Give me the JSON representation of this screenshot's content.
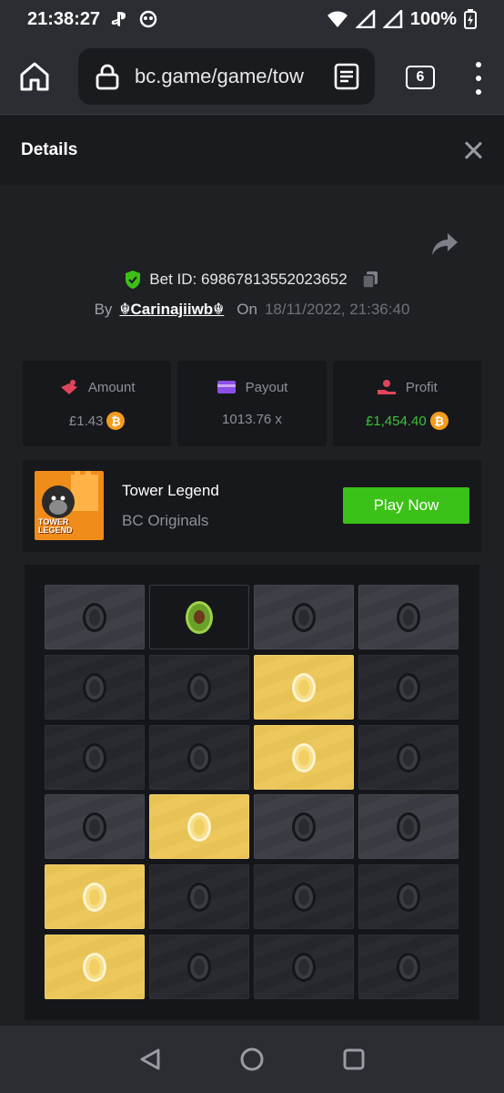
{
  "status_bar": {
    "time": "21:38:27",
    "battery": "100%"
  },
  "browser": {
    "url": "bc.game/game/tow",
    "tab_count": "6"
  },
  "panel": {
    "title": "Details"
  },
  "bet": {
    "id_text": "Bet ID: 69867813552023652",
    "by_label": "By",
    "username": "☬Carinajiiwb☬",
    "on_label": "On",
    "date": "18/11/2022, 21:36:40"
  },
  "stats": {
    "amount": {
      "label": "Amount",
      "value": "£1.43"
    },
    "payout": {
      "label": "Payout",
      "value": "1013.76 x"
    },
    "profit": {
      "label": "Profit",
      "value": "£1,454.40"
    }
  },
  "game": {
    "name": "Tower Legend",
    "provider": "BC Originals",
    "play_label": "Play Now",
    "thumb_text": "TOWER LEGEND"
  },
  "board": {
    "rows": [
      [
        "light",
        "avocado",
        "light",
        "light"
      ],
      [
        "dark",
        "dark",
        "gold",
        "dark"
      ],
      [
        "dark",
        "dark",
        "gold",
        "dark"
      ],
      [
        "light",
        "gold",
        "light",
        "light"
      ],
      [
        "gold",
        "dark",
        "dark",
        "dark"
      ],
      [
        "gold",
        "dark",
        "dark",
        "dark"
      ]
    ]
  },
  "colors": {
    "accent_green": "#3bc117",
    "profit_green": "#3cc13b",
    "coin_orange": "#f39b1c",
    "tile_gold": "#e7c255"
  }
}
